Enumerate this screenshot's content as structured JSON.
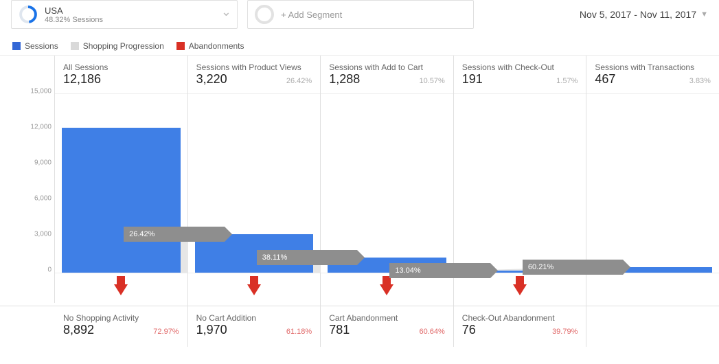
{
  "segment": {
    "name": "USA",
    "subtext": "48.32% Sessions"
  },
  "add_segment_label": "+ Add Segment",
  "date_range": "Nov 5, 2017 - Nov 11, 2017",
  "legend": {
    "sessions": "Sessions",
    "progression": "Shopping Progression",
    "abandon": "Abandonments"
  },
  "y_ticks": [
    "0",
    "3,000",
    "6,000",
    "9,000",
    "12,000",
    "15,000"
  ],
  "stages": [
    {
      "label": "All Sessions",
      "value": "12,186",
      "pct": "",
      "progression_pct": "26.42%"
    },
    {
      "label": "Sessions with Product Views",
      "value": "3,220",
      "pct": "26.42%",
      "progression_pct": "38.11%"
    },
    {
      "label": "Sessions with Add to Cart",
      "value": "1,288",
      "pct": "10.57%",
      "progression_pct": "13.04%"
    },
    {
      "label": "Sessions with Check-Out",
      "value": "191",
      "pct": "1.57%",
      "progression_pct": "60.21%"
    },
    {
      "label": "Sessions with Transactions",
      "value": "467",
      "pct": "3.83%",
      "progression_pct": ""
    }
  ],
  "abandon": [
    {
      "label": "No Shopping Activity",
      "value": "8,892",
      "pct": "72.97%"
    },
    {
      "label": "No Cart Addition",
      "value": "1,970",
      "pct": "61.18%"
    },
    {
      "label": "Cart Abandonment",
      "value": "781",
      "pct": "60.64%"
    },
    {
      "label": "Check-Out Abandonment",
      "value": "76",
      "pct": "39.79%"
    }
  ],
  "chart_data": {
    "type": "bar",
    "title": "Shopping Behavior Funnel",
    "ylabel": "Sessions",
    "ylim": [
      0,
      15000
    ],
    "categories": [
      "All Sessions",
      "Sessions with Product Views",
      "Sessions with Add to Cart",
      "Sessions with Check-Out",
      "Sessions with Transactions"
    ],
    "values": [
      12186,
      3220,
      1288,
      191,
      467
    ],
    "progression_pct_to_next": [
      26.42,
      38.11,
      13.04,
      60.21
    ],
    "abandonment": {
      "categories": [
        "No Shopping Activity",
        "No Cart Addition",
        "Cart Abandonment",
        "Check-Out Abandonment"
      ],
      "values": [
        8892,
        1970,
        781,
        76
      ],
      "pct_of_stage": [
        72.97,
        61.18,
        60.64,
        39.79
      ]
    }
  }
}
